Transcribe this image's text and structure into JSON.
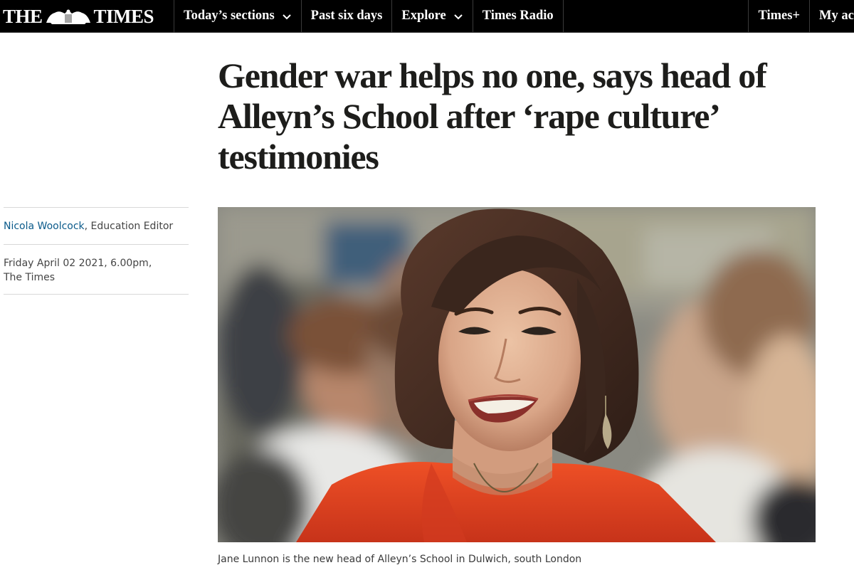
{
  "header": {
    "logo_left": "THE",
    "logo_right": "TIMES",
    "nav": [
      {
        "label": "Today’s sections",
        "has_dropdown": true,
        "icon": "chevron-down-icon"
      },
      {
        "label": "Past six days",
        "has_dropdown": false
      },
      {
        "label": "Explore",
        "has_dropdown": true,
        "icon": "chevron-down-icon"
      },
      {
        "label": "Times Radio",
        "has_dropdown": false
      }
    ],
    "right": {
      "times_plus": "Times+",
      "my_account": "My ac"
    }
  },
  "article": {
    "headline": "Gender war helps no one, says head of Alleyn’s School after ‘rape culture’ testimonies",
    "author_name": "Nicola Woolcock",
    "author_role": ", Education Editor",
    "date_line": "Friday April 02 2021, 6.00pm,",
    "publication": "The Times",
    "image_caption": "Jane Lunnon is the new head of Alleyn’s School in Dulwich, south London"
  },
  "colors": {
    "nav_bg": "#000000",
    "nav_text": "#ffffff",
    "headline": "#1d1d1b",
    "author_link": "#0a5a8a",
    "coat_red": "#e0401f"
  }
}
